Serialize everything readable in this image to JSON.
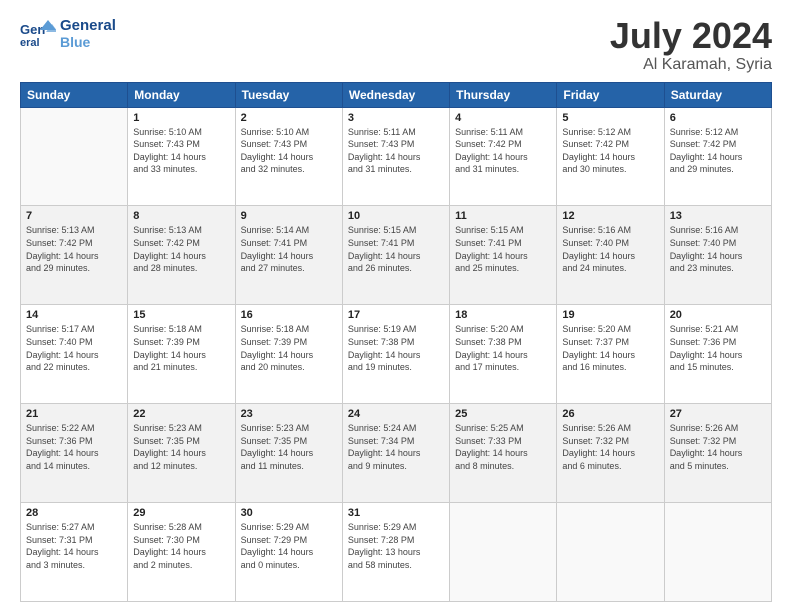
{
  "logo": {
    "line1": "General",
    "line2": "Blue"
  },
  "title": "July 2024",
  "location": "Al Karamah, Syria",
  "days_of_week": [
    "Sunday",
    "Monday",
    "Tuesday",
    "Wednesday",
    "Thursday",
    "Friday",
    "Saturday"
  ],
  "weeks": [
    [
      {
        "num": "",
        "info": ""
      },
      {
        "num": "1",
        "info": "Sunrise: 5:10 AM\nSunset: 7:43 PM\nDaylight: 14 hours\nand 33 minutes."
      },
      {
        "num": "2",
        "info": "Sunrise: 5:10 AM\nSunset: 7:43 PM\nDaylight: 14 hours\nand 32 minutes."
      },
      {
        "num": "3",
        "info": "Sunrise: 5:11 AM\nSunset: 7:43 PM\nDaylight: 14 hours\nand 31 minutes."
      },
      {
        "num": "4",
        "info": "Sunrise: 5:11 AM\nSunset: 7:42 PM\nDaylight: 14 hours\nand 31 minutes."
      },
      {
        "num": "5",
        "info": "Sunrise: 5:12 AM\nSunset: 7:42 PM\nDaylight: 14 hours\nand 30 minutes."
      },
      {
        "num": "6",
        "info": "Sunrise: 5:12 AM\nSunset: 7:42 PM\nDaylight: 14 hours\nand 29 minutes."
      }
    ],
    [
      {
        "num": "7",
        "info": "Sunrise: 5:13 AM\nSunset: 7:42 PM\nDaylight: 14 hours\nand 29 minutes."
      },
      {
        "num": "8",
        "info": "Sunrise: 5:13 AM\nSunset: 7:42 PM\nDaylight: 14 hours\nand 28 minutes."
      },
      {
        "num": "9",
        "info": "Sunrise: 5:14 AM\nSunset: 7:41 PM\nDaylight: 14 hours\nand 27 minutes."
      },
      {
        "num": "10",
        "info": "Sunrise: 5:15 AM\nSunset: 7:41 PM\nDaylight: 14 hours\nand 26 minutes."
      },
      {
        "num": "11",
        "info": "Sunrise: 5:15 AM\nSunset: 7:41 PM\nDaylight: 14 hours\nand 25 minutes."
      },
      {
        "num": "12",
        "info": "Sunrise: 5:16 AM\nSunset: 7:40 PM\nDaylight: 14 hours\nand 24 minutes."
      },
      {
        "num": "13",
        "info": "Sunrise: 5:16 AM\nSunset: 7:40 PM\nDaylight: 14 hours\nand 23 minutes."
      }
    ],
    [
      {
        "num": "14",
        "info": "Sunrise: 5:17 AM\nSunset: 7:40 PM\nDaylight: 14 hours\nand 22 minutes."
      },
      {
        "num": "15",
        "info": "Sunrise: 5:18 AM\nSunset: 7:39 PM\nDaylight: 14 hours\nand 21 minutes."
      },
      {
        "num": "16",
        "info": "Sunrise: 5:18 AM\nSunset: 7:39 PM\nDaylight: 14 hours\nand 20 minutes."
      },
      {
        "num": "17",
        "info": "Sunrise: 5:19 AM\nSunset: 7:38 PM\nDaylight: 14 hours\nand 19 minutes."
      },
      {
        "num": "18",
        "info": "Sunrise: 5:20 AM\nSunset: 7:38 PM\nDaylight: 14 hours\nand 17 minutes."
      },
      {
        "num": "19",
        "info": "Sunrise: 5:20 AM\nSunset: 7:37 PM\nDaylight: 14 hours\nand 16 minutes."
      },
      {
        "num": "20",
        "info": "Sunrise: 5:21 AM\nSunset: 7:36 PM\nDaylight: 14 hours\nand 15 minutes."
      }
    ],
    [
      {
        "num": "21",
        "info": "Sunrise: 5:22 AM\nSunset: 7:36 PM\nDaylight: 14 hours\nand 14 minutes."
      },
      {
        "num": "22",
        "info": "Sunrise: 5:23 AM\nSunset: 7:35 PM\nDaylight: 14 hours\nand 12 minutes."
      },
      {
        "num": "23",
        "info": "Sunrise: 5:23 AM\nSunset: 7:35 PM\nDaylight: 14 hours\nand 11 minutes."
      },
      {
        "num": "24",
        "info": "Sunrise: 5:24 AM\nSunset: 7:34 PM\nDaylight: 14 hours\nand 9 minutes."
      },
      {
        "num": "25",
        "info": "Sunrise: 5:25 AM\nSunset: 7:33 PM\nDaylight: 14 hours\nand 8 minutes."
      },
      {
        "num": "26",
        "info": "Sunrise: 5:26 AM\nSunset: 7:32 PM\nDaylight: 14 hours\nand 6 minutes."
      },
      {
        "num": "27",
        "info": "Sunrise: 5:26 AM\nSunset: 7:32 PM\nDaylight: 14 hours\nand 5 minutes."
      }
    ],
    [
      {
        "num": "28",
        "info": "Sunrise: 5:27 AM\nSunset: 7:31 PM\nDaylight: 14 hours\nand 3 minutes."
      },
      {
        "num": "29",
        "info": "Sunrise: 5:28 AM\nSunset: 7:30 PM\nDaylight: 14 hours\nand 2 minutes."
      },
      {
        "num": "30",
        "info": "Sunrise: 5:29 AM\nSunset: 7:29 PM\nDaylight: 14 hours\nand 0 minutes."
      },
      {
        "num": "31",
        "info": "Sunrise: 5:29 AM\nSunset: 7:28 PM\nDaylight: 13 hours\nand 58 minutes."
      },
      {
        "num": "",
        "info": ""
      },
      {
        "num": "",
        "info": ""
      },
      {
        "num": "",
        "info": ""
      }
    ]
  ]
}
